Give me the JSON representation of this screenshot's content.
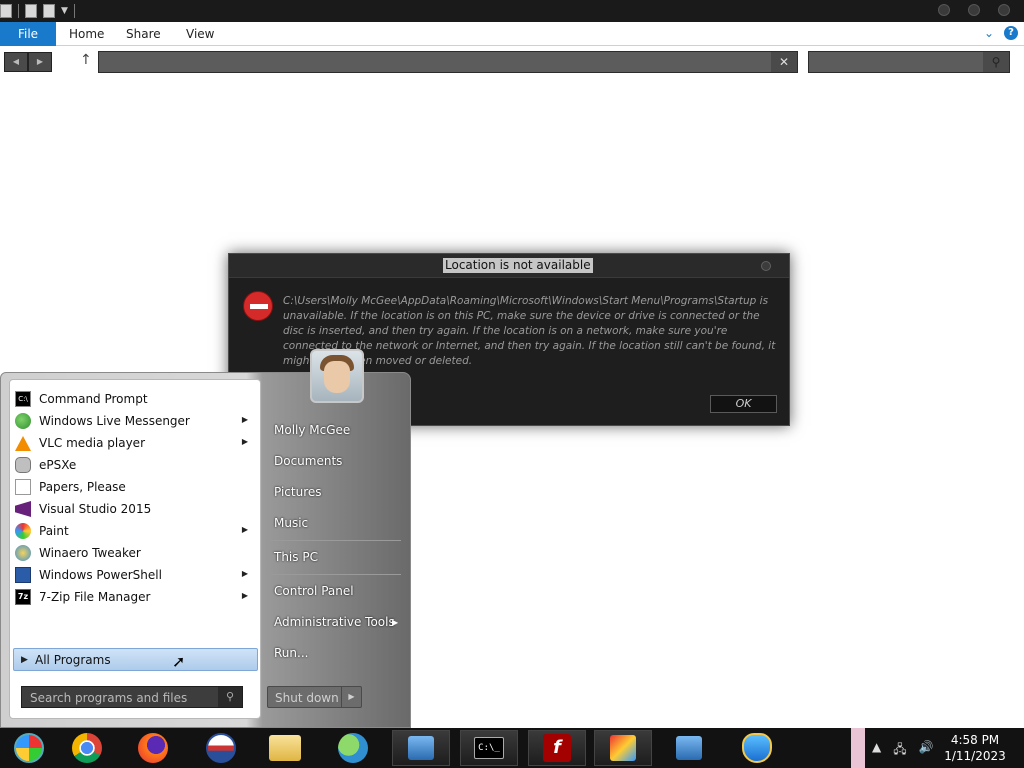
{
  "ribbon": {
    "file": "File",
    "home": "Home",
    "share": "Share",
    "view": "View"
  },
  "dialog": {
    "title": "Location is not available",
    "message": "C:\\Users\\Molly McGee\\AppData\\Roaming\\Microsoft\\Windows\\Start Menu\\Programs\\Startup is unavailable. If the location is on this PC, make sure the device or drive is connected or the disc is inserted, and then try again. If the location is on a network, make sure you're connected to the network or Internet, and then try again. If the location still can't be found, it might have been moved or deleted.",
    "ok_label": "OK",
    "icon": "error-icon"
  },
  "start_menu": {
    "programs": [
      {
        "label": "Command Prompt",
        "icon": "cmd-icon",
        "submenu": false
      },
      {
        "label": "Windows Live Messenger",
        "icon": "messenger-icon",
        "submenu": true
      },
      {
        "label": "VLC media player",
        "icon": "vlc-icon",
        "submenu": true
      },
      {
        "label": "ePSXe",
        "icon": "gamepad-icon",
        "submenu": false
      },
      {
        "label": "Papers, Please",
        "icon": "document-icon",
        "submenu": false
      },
      {
        "label": "Visual Studio 2015",
        "icon": "visual-studio-icon",
        "submenu": false
      },
      {
        "label": "Paint",
        "icon": "paint-icon",
        "submenu": true
      },
      {
        "label": "Winaero Tweaker",
        "icon": "tweaker-icon",
        "submenu": false
      },
      {
        "label": "Windows PowerShell",
        "icon": "powershell-icon",
        "submenu": true
      },
      {
        "label": "7-Zip File Manager",
        "icon": "7zip-icon",
        "submenu": true
      }
    ],
    "all_programs": "All Programs",
    "search_placeholder": "Search programs and files",
    "right": {
      "user": "Molly McGee",
      "documents": "Documents",
      "pictures": "Pictures",
      "music": "Music",
      "this_pc": "This PC",
      "control_panel": "Control Panel",
      "admin_tools": "Administrative Tools",
      "run": "Run..."
    },
    "shutdown_label": "Shut down"
  },
  "taskbar": {
    "time": "4:58 PM",
    "date": "1/11/2023"
  }
}
